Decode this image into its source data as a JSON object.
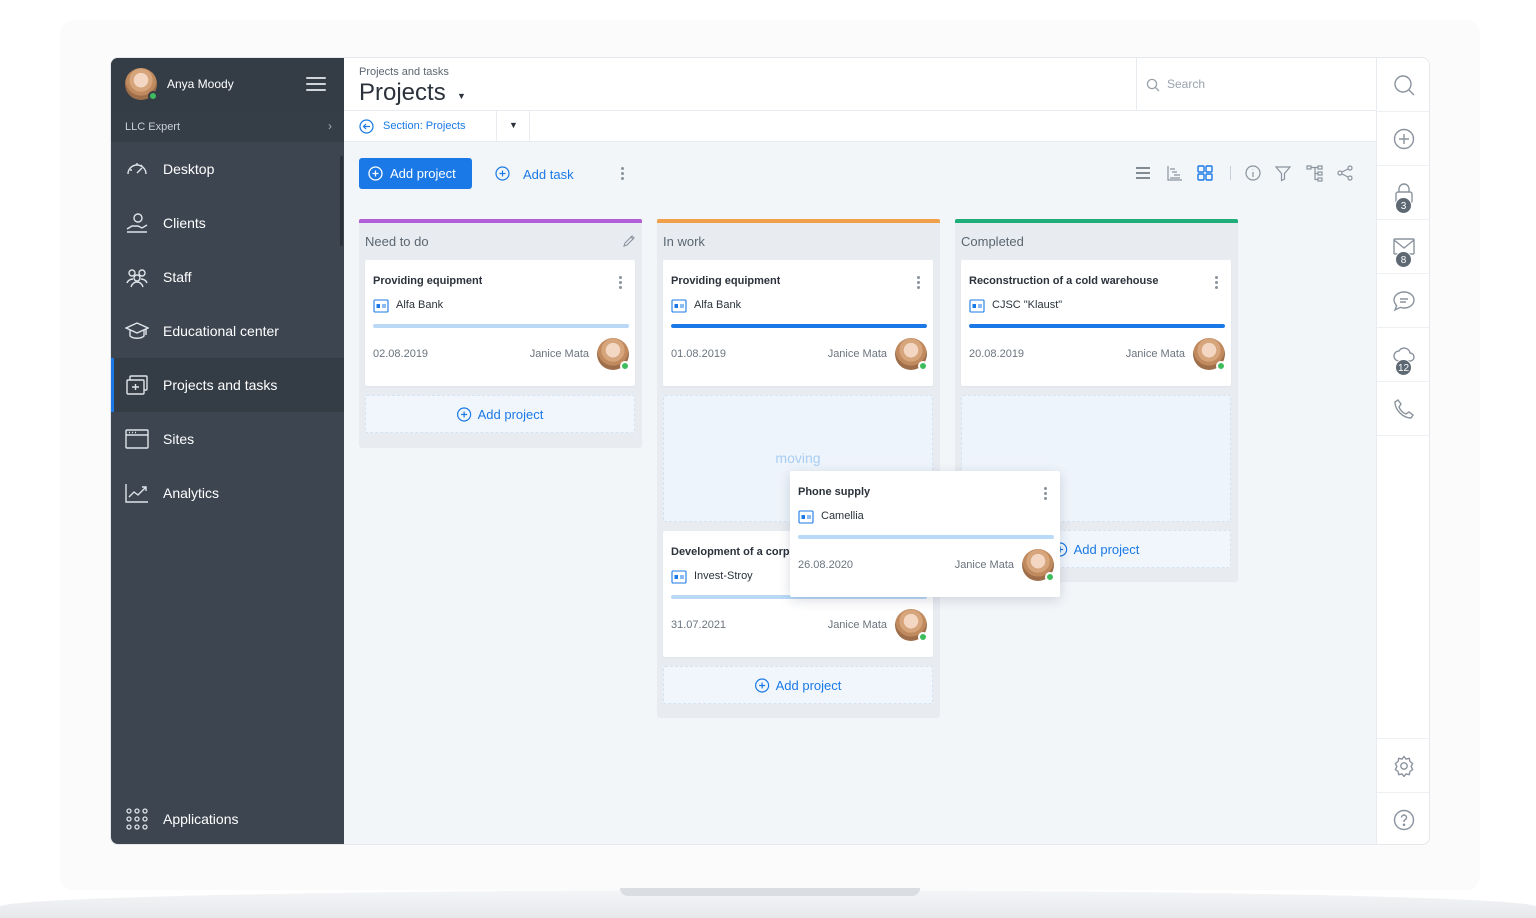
{
  "user": {
    "name": "Anya Moody"
  },
  "company": {
    "label": "LLC Expert"
  },
  "sidebar": {
    "items": [
      {
        "label": "Desktop",
        "icon": "speedometer-icon"
      },
      {
        "label": "Clients",
        "icon": "hand-money-icon"
      },
      {
        "label": "Staff",
        "icon": "people-icon"
      },
      {
        "label": "Educational center",
        "icon": "graduation-cap-icon"
      },
      {
        "label": "Projects and tasks",
        "icon": "projects-icon",
        "active": true
      },
      {
        "label": "Sites",
        "icon": "browser-window-icon"
      },
      {
        "label": "Analytics",
        "icon": "trend-chart-icon"
      }
    ],
    "applications": {
      "label": "Applications",
      "icon": "app-grid-icon"
    }
  },
  "header": {
    "breadcrumb": "Projects and tasks",
    "title": "Projects",
    "search_placeholder": "Search"
  },
  "subheader": {
    "section_label": "Section: Projects"
  },
  "toolbar": {
    "add_project": "Add project",
    "add_task": "Add task"
  },
  "view_tools": [
    "list-view-icon",
    "gantt-view-icon",
    "kanban-view-icon",
    "info-icon",
    "filter-icon",
    "hierarchy-icon",
    "share-icon"
  ],
  "board": {
    "columns": [
      {
        "title": "Need to do",
        "color": "#b15fd6",
        "cards": [
          {
            "title": "Providing equipment",
            "client": "Alfa Bank",
            "progress": 0.0,
            "date": "02.08.2019",
            "owner": "Janice Mata"
          }
        ],
        "add_label": "Add project"
      },
      {
        "title": "In work",
        "color": "#f0a04b",
        "placeholder_label": "moving",
        "cards": [
          {
            "title": "Providing equipment",
            "client": "Alfa Bank",
            "progress": 1.0,
            "date": "01.08.2019",
            "owner": "Janice Mata"
          },
          {
            "title": "Development of a corpo",
            "client": "Invest-Stroy",
            "progress": 0.0,
            "date": "31.07.2021",
            "owner": "Janice Mata"
          }
        ],
        "add_label": "Add project"
      },
      {
        "title": "Completed",
        "color": "#1fae7a",
        "cards": [
          {
            "title": "Reconstruction of a cold warehouse",
            "client": "CJSC \"Klaust\"",
            "progress": 1.0,
            "date": "20.08.2019",
            "owner": "Janice Mata"
          }
        ],
        "add_label": "Add project"
      }
    ],
    "dragging_card": {
      "title": "Phone supply",
      "client": "Camellia",
      "progress": 0.0,
      "date": "26.08.2020",
      "owner": "Janice Mata"
    }
  },
  "rail": {
    "items": [
      {
        "icon": "search-icon"
      },
      {
        "icon": "plus-circle-icon"
      },
      {
        "icon": "lock-icon",
        "badge": "3"
      },
      {
        "icon": "mail-icon",
        "badge": "8"
      },
      {
        "icon": "chat-icon"
      },
      {
        "icon": "cloud-icon",
        "badge": "12"
      },
      {
        "icon": "phone-icon"
      }
    ],
    "bottom": [
      {
        "icon": "gear-icon"
      },
      {
        "icon": "help-icon"
      }
    ]
  },
  "colors": {
    "accent": "#1a79e6",
    "sidebar": "#3c4550",
    "online": "#3ebd5e"
  }
}
